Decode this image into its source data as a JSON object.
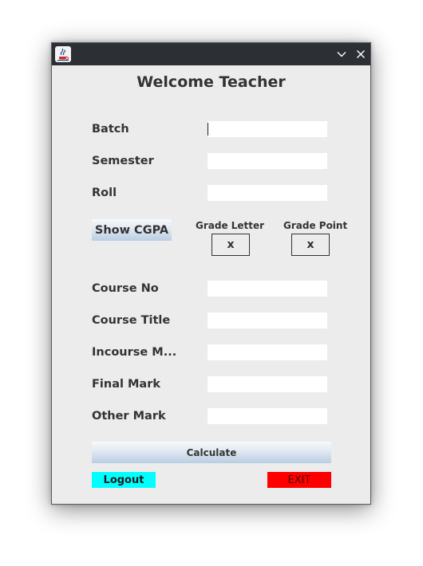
{
  "window": {
    "title": "",
    "heading": "Welcome Teacher"
  },
  "titlebar_icons": {
    "app": "java-cup-icon",
    "minimize": "chevron-down-icon",
    "close": "close-icon"
  },
  "form": {
    "batch_label": "Batch",
    "batch_value": "",
    "semester_label": "Semester",
    "semester_value": "",
    "roll_label": "Roll",
    "roll_value": ""
  },
  "cgpa": {
    "button_label": "Show CGPA",
    "grade_letter_label": "Grade Letter",
    "grade_letter_value": "x",
    "grade_point_label": "Grade Point",
    "grade_point_value": "x"
  },
  "course": {
    "course_no_label": "Course No",
    "course_no_value": "",
    "course_title_label": "Course Title",
    "course_title_value": "",
    "incourse_label": "Incourse M...",
    "incourse_value": "",
    "final_label": "Final Mark",
    "final_value": "",
    "other_label": "Other Mark",
    "other_value": ""
  },
  "actions": {
    "calculate_label": "Calculate",
    "logout_label": "Logout",
    "exit_label": "EXIT"
  },
  "colors": {
    "window_bg": "#ececec",
    "titlebar_bg": "#2c3035",
    "logout_bg": "#00ffff",
    "exit_bg": "#ff0000"
  }
}
